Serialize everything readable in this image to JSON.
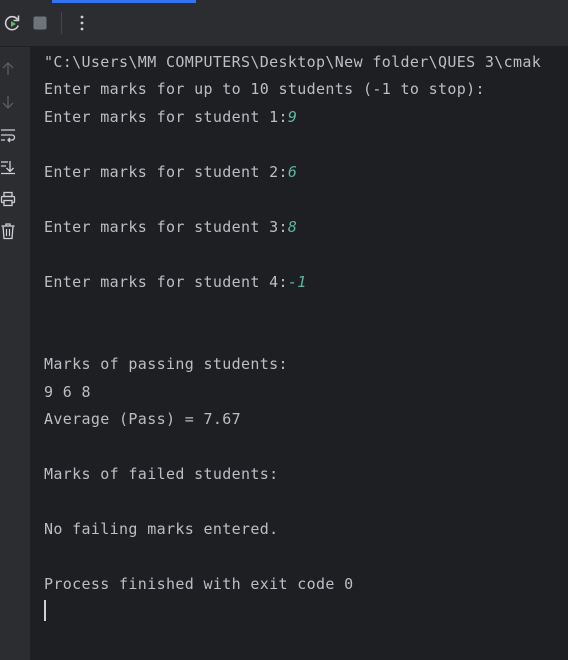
{
  "colors": {
    "background": "#1e1f22",
    "toolbar": "#2b2d30",
    "text": "#bcbec4",
    "user_input": "#5fb4a2",
    "accent": "#3574f0"
  },
  "toolbar": {
    "icons": [
      "rerun-icon",
      "stop-icon",
      "more-options-icon"
    ]
  },
  "gutter": {
    "icons": [
      "scroll-up-icon",
      "scroll-down-icon",
      "soft-wrap-icon",
      "scroll-to-end-icon",
      "print-icon",
      "clear-all-icon"
    ]
  },
  "console": {
    "command_line": "\"C:\\Users\\MM COMPUTERS\\Desktop\\New folder\\QUES 3\\cmak",
    "intro": "Enter marks for up to 10 students (-1 to stop):",
    "prompts": [
      {
        "prompt": "Enter marks for student 1:",
        "input": "9"
      },
      {
        "prompt": "Enter marks for student 2:",
        "input": "6"
      },
      {
        "prompt": "Enter marks for student 3:",
        "input": "8"
      },
      {
        "prompt": "Enter marks for student 4:",
        "input": "-1"
      }
    ],
    "passing_header": "Marks of passing students:",
    "passing_marks": "9 6 8",
    "average": "Average (Pass) = 7.67",
    "failed_header": "Marks of failed students:",
    "no_failing": "No failing marks entered.",
    "exit_message": "Process finished with exit code 0"
  }
}
